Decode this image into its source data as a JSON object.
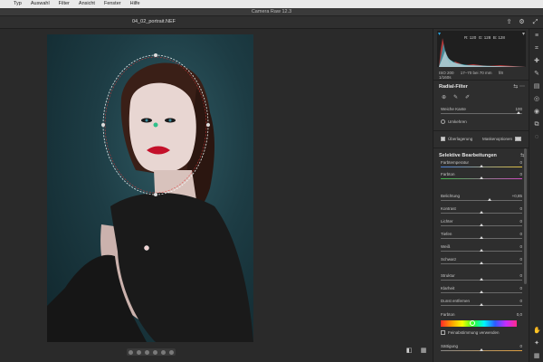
{
  "menubar": {
    "items": [
      "Typ",
      "Auswahl",
      "Filter",
      "Ansicht",
      "Fenster",
      "Hilfe"
    ]
  },
  "window": {
    "title": "Camera Raw 12.3"
  },
  "file": {
    "name": "04_02_portrait.NEF"
  },
  "histogram": {
    "r": "R: 120",
    "g": "G: 128",
    "b": "B: 128"
  },
  "camera": {
    "iso": "ISO 200",
    "lens": "17–70 bei 70 mm",
    "aperture": "f/8",
    "shutter": "1/160s"
  },
  "radial_filter": {
    "title": "Radial-Filter",
    "soft_edge": {
      "label": "Weiche Kante",
      "value": "100",
      "pos": 0.95
    },
    "invert_label": "Umkehren",
    "overlay_label": "Überlagerung",
    "mask_label": "Maskenoptionen"
  },
  "selective": {
    "title": "Selektive Bearbeitungen",
    "sliders": [
      {
        "label": "Farbtemperatur",
        "value": "0",
        "pos": 0.5
      },
      {
        "label": "Farbton",
        "value": "0",
        "pos": 0.5
      },
      {
        "label": "Belichtung",
        "value": "+0,85",
        "pos": 0.6
      },
      {
        "label": "Kontrast",
        "value": "0",
        "pos": 0.5
      },
      {
        "label": "Lichter",
        "value": "0",
        "pos": 0.5
      },
      {
        "label": "Tiefen",
        "value": "0",
        "pos": 0.5
      },
      {
        "label": "Weiß",
        "value": "0",
        "pos": 0.5
      },
      {
        "label": "Schwarz",
        "value": "0",
        "pos": 0.5
      },
      {
        "label": "Struktur",
        "value": "0",
        "pos": 0.5
      },
      {
        "label": "Klarheit",
        "value": "0",
        "pos": 0.5
      },
      {
        "label": "Dunst entfernen",
        "value": "0",
        "pos": 0.5
      }
    ],
    "hue": {
      "label": "Farbton",
      "value": "0,0",
      "pos": 0.42
    },
    "fine_label": "Feinabstimmung verwenden",
    "saturation": {
      "label": "Sättigung",
      "value": "0",
      "pos": 0.5
    }
  },
  "colors": {
    "accent": "#d8d8d8",
    "panel": "#2e2e2e"
  }
}
